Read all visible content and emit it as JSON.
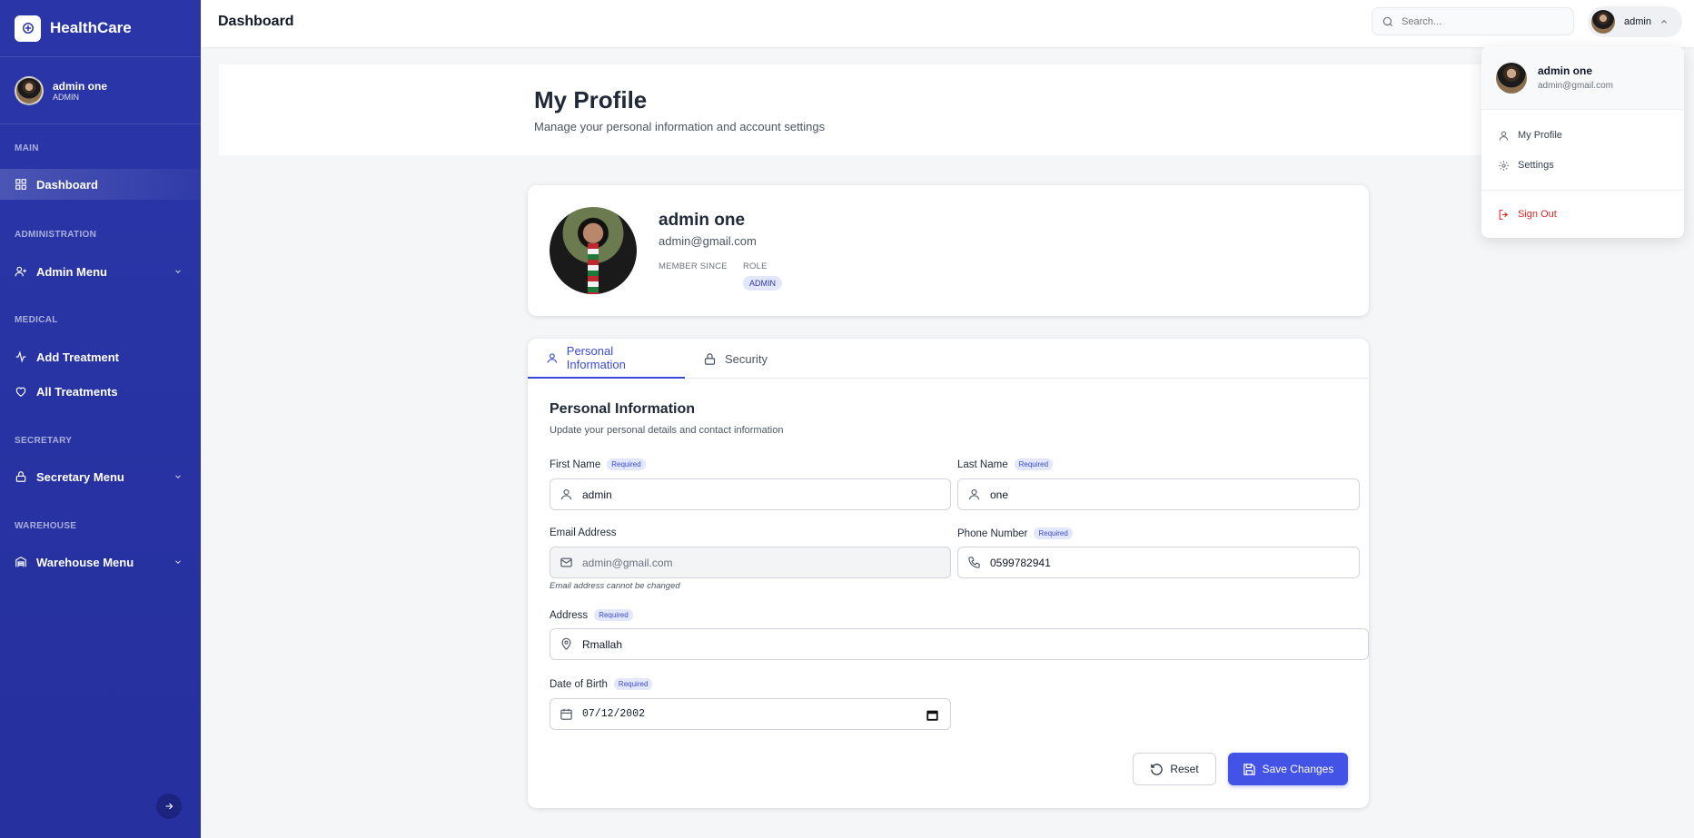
{
  "app": {
    "brand": "HealthCare"
  },
  "sidebar": {
    "user": {
      "name": "admin one",
      "role": "ADMIN"
    },
    "sections": {
      "main": "MAIN",
      "administration": "ADMINISTRATION",
      "medical": "MEDICAL",
      "secretary": "SECRETARY",
      "warehouse": "WAREHOUSE"
    },
    "items": {
      "dashboard": "Dashboard",
      "admin_menu": "Admin Menu",
      "add_treatment": "Add Treatment",
      "all_treatments": "All Treatments",
      "secretary_menu": "Secretary Menu",
      "warehouse_menu": "Warehouse Menu"
    },
    "active_item": "Dashboard"
  },
  "topbar": {
    "title": "Dashboard",
    "search_placeholder": "Search...",
    "user_label": "admin"
  },
  "dropdown": {
    "name": "admin one",
    "email": "admin@gmail.com",
    "my_profile": "My Profile",
    "settings": "Settings",
    "sign_out": "Sign Out"
  },
  "page": {
    "title": "My Profile",
    "subtitle": "Manage your personal information and account settings"
  },
  "profile_card": {
    "name": "admin one",
    "email": "admin@gmail.com",
    "member_since_label": "MEMBER SINCE",
    "role_label": "ROLE",
    "role_value": "ADMIN"
  },
  "tabs": {
    "personal": "Personal Information",
    "security": "Security",
    "active": "Personal Information"
  },
  "form": {
    "title": "Personal Information",
    "subtitle": "Update your personal details and contact information",
    "required_badge": "Required",
    "first_name": {
      "label": "First Name",
      "value": "admin"
    },
    "last_name": {
      "label": "Last Name",
      "value": "one"
    },
    "email": {
      "label": "Email Address",
      "value": "admin@gmail.com",
      "hint": "Email address cannot be changed"
    },
    "phone": {
      "label": "Phone Number",
      "value": "0599782941"
    },
    "address": {
      "label": "Address",
      "value": "Rmallah"
    },
    "dob": {
      "label": "Date of Birth",
      "value": "07/12/2002"
    },
    "reset_label": "Reset",
    "save_label": "Save Changes"
  },
  "colors": {
    "sidebar_bg": "#2a36a8",
    "accent": "#4353e6",
    "danger": "#dc2626"
  }
}
